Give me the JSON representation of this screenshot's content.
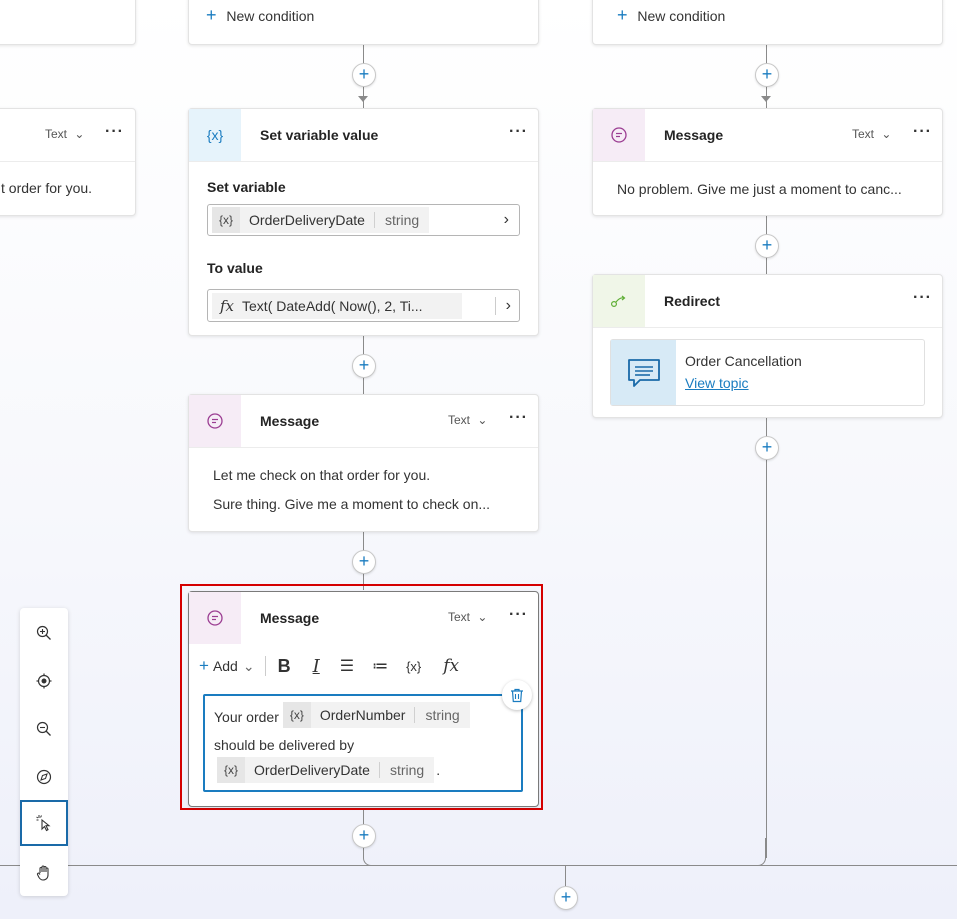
{
  "add_condition_label": "New condition",
  "left_card": {
    "type_label": "Text",
    "message_text": "t order for you."
  },
  "set_var_card": {
    "title": "Set variable value",
    "var_icon": "{x}",
    "set_label": "Set variable",
    "variable": {
      "name": "OrderDeliveryDate",
      "type": "string"
    },
    "to_value_label": "To value",
    "formula_icon": "fx",
    "formula_value": "Text( DateAdd( Now(), 2, Ti..."
  },
  "msg_card_1": {
    "title": "Message",
    "type_label": "Text",
    "lines": [
      "Let me check on that order for you.",
      "Sure thing. Give me a moment to check on..."
    ]
  },
  "msg_card_2": {
    "title": "Message",
    "type_label": "Text",
    "toolbar": {
      "add_label": "Add",
      "bold": "B",
      "italic": "I",
      "var_btn": "{x}",
      "fx_btn": "fx"
    },
    "content": {
      "prefix": "Your order",
      "var1": {
        "name": "OrderNumber",
        "type": "string"
      },
      "middle": "should be delivered by",
      "var2": {
        "name": "OrderDeliveryDate",
        "type": "string"
      },
      "suffix": "."
    }
  },
  "right_msg_card": {
    "title": "Message",
    "type_label": "Text",
    "message_text": "No problem. Give me just a moment to canc..."
  },
  "redirect_card": {
    "title": "Redirect",
    "topic_name": "Order Cancellation",
    "topic_link": "View topic"
  },
  "canvas_tools": [
    "zoom-in",
    "fit-to-view",
    "zoom-out",
    "mini-map",
    "select-mode",
    "pan-mode"
  ],
  "colors": {
    "accent": "#1a7cc0",
    "highlight": "#d50000",
    "message_tile": "#f6ecf6",
    "variable_tile": "#e6f3fb",
    "redirect_tile": "#f0f6e8"
  }
}
